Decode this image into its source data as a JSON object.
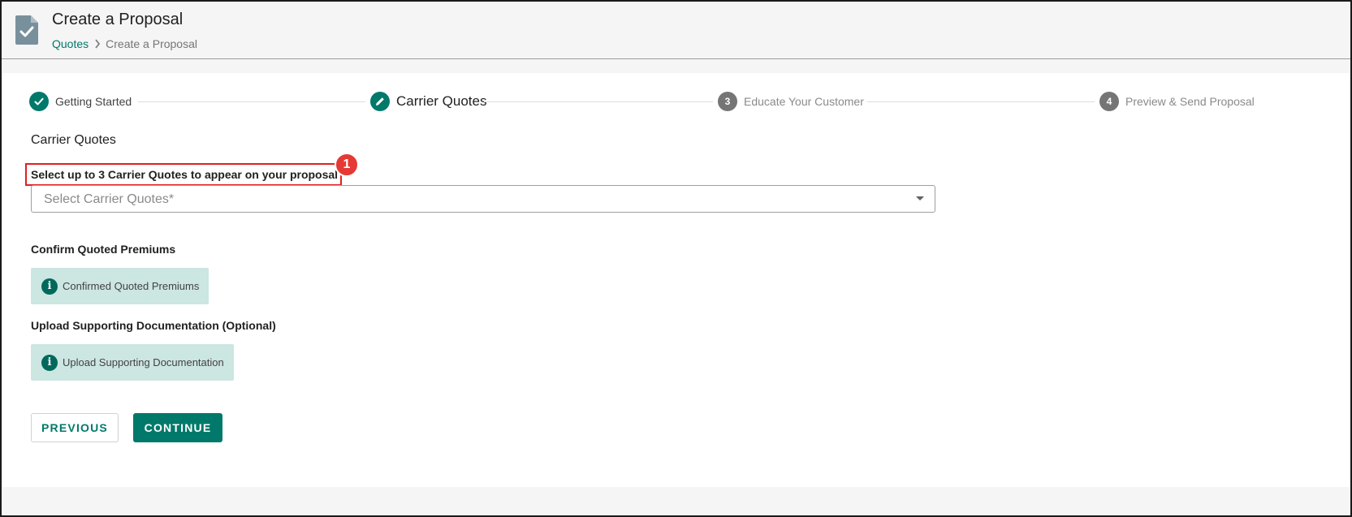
{
  "header": {
    "title": "Create a Proposal",
    "breadcrumb": {
      "link": "Quotes",
      "current": "Create a Proposal"
    },
    "icon": "document-check-icon"
  },
  "stepper": {
    "steps": [
      {
        "label": "Getting Started",
        "state": "completed",
        "icon": "check-icon"
      },
      {
        "label": "Carrier Quotes",
        "state": "active",
        "icon": "pencil-icon"
      },
      {
        "label": "Educate Your Customer",
        "state": "upcoming",
        "number": "3"
      },
      {
        "label": "Preview & Send Proposal",
        "state": "upcoming",
        "number": "4"
      }
    ]
  },
  "main": {
    "section_title": "Carrier Quotes",
    "select_instruction": "Select up to 3 Carrier Quotes to appear on your proposal",
    "annotation_badge": "1",
    "select": {
      "placeholder": "Select Carrier Quotes*"
    },
    "confirm": {
      "heading": "Confirm Quoted Premiums",
      "button_label": "Confirmed Quoted Premiums"
    },
    "upload": {
      "heading": "Upload Supporting Documentation (Optional)",
      "button_label": "Upload Supporting Documentation"
    },
    "info_icon_glyph": "i"
  },
  "actions": {
    "previous": "PREVIOUS",
    "continue": "CONTINUE"
  },
  "colors": {
    "accent": "#00796b",
    "info_background": "#cce6e2",
    "highlight": "#e02020",
    "inactive_step": "#757575"
  }
}
